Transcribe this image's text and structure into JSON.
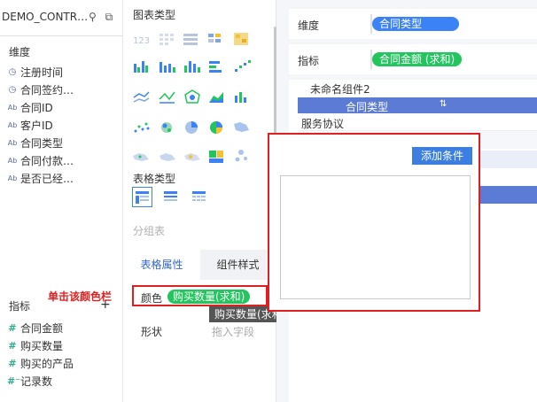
{
  "left_panel": {
    "dataset_title": "DEMO_CONTR…",
    "dimension_label": "维度",
    "dimensions": [
      {
        "icon": "clock-icon",
        "label": "注册时间"
      },
      {
        "icon": "clock-icon",
        "label": "合同签约…"
      },
      {
        "icon": "text-type-icon",
        "label": "合同ID"
      },
      {
        "icon": "text-type-icon",
        "label": "客户ID"
      },
      {
        "icon": "text-type-icon",
        "label": "合同类型"
      },
      {
        "icon": "text-type-icon",
        "label": "合同付款…"
      },
      {
        "icon": "text-type-icon",
        "label": "是否已经…"
      }
    ],
    "measure_label": "指标",
    "measures": [
      {
        "icon": "number-icon",
        "label": "合同金额"
      },
      {
        "icon": "number-icon",
        "label": "购买数量"
      },
      {
        "icon": "number-icon",
        "label": "购买的产品"
      },
      {
        "icon": "number-icon",
        "label": "记录数"
      }
    ],
    "type_icon_text": "Ab",
    "num_icon_text": "#",
    "count_icon_text": "#⁻"
  },
  "chart_panel": {
    "chart_type_title": "图表类型",
    "table_type_title": "表格类型",
    "group_table_label": "分组表",
    "tabs": [
      "表格属性",
      "组件样式"
    ],
    "color_label": "颜色",
    "color_field": "购买数量(求和)",
    "shape_label": "形状",
    "shape_placeholder": "拖入字段"
  },
  "annotation": {
    "click_note": "单击该颜色栏",
    "tooltip": "购买数量(求和)"
  },
  "right_panel": {
    "dimension_label": "维度",
    "dimension_field": "合同类型",
    "measure_label": "指标",
    "measure_field": "合同金额 (求和)",
    "component_name": "未命名组件2",
    "table_header": "合同类型",
    "table_row1": "服务协议"
  },
  "popup": {
    "add_condition_label": "添加条件"
  },
  "colors": {
    "accent_blue": "#3b82f6",
    "accent_green": "#22c55e",
    "highlight_red": "#e02020"
  }
}
